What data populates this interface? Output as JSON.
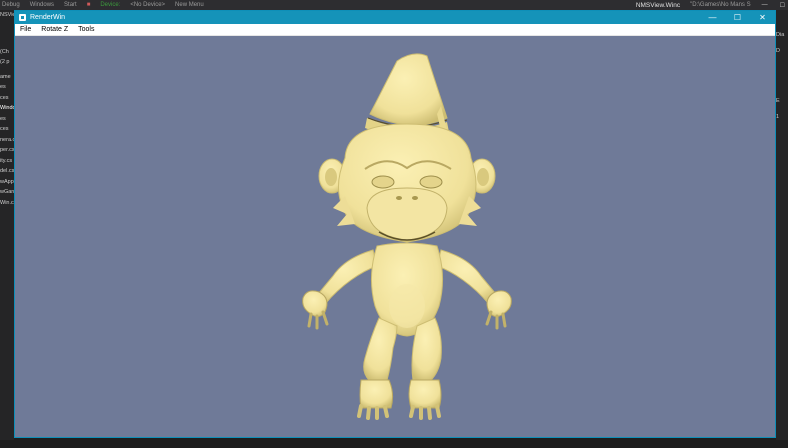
{
  "ide": {
    "toolbar_items": [
      "Debug",
      "Windows",
      "Start",
      "Device:",
      "<No Device>",
      "New Menu"
    ],
    "file_name": "NMSView.Winc",
    "path": "\"D:\\Games\\No Mans S"
  },
  "ide_left_items": [
    "NSView",
    "(Ch",
    "(2 p",
    "ame",
    "es",
    "ces",
    "Windo",
    "es",
    "ces",
    "nera.c",
    "per.cs",
    "ity.cs",
    "del.cs",
    "wApp",
    "wGarr",
    "Win.cs"
  ],
  "ide_right_items": [
    "Dia",
    "D",
    "E",
    "1"
  ],
  "window": {
    "title": "RenderWin",
    "minimize": "—",
    "maximize": "☐",
    "close": "✕"
  },
  "menu": {
    "items": [
      "File",
      "Rotate Z",
      "Tools"
    ]
  },
  "viewport": {
    "background": "#6f7a98",
    "model_color": "#f0e19a",
    "model_shade": "#cdbd72",
    "model_dark": "#8a7d3e"
  }
}
